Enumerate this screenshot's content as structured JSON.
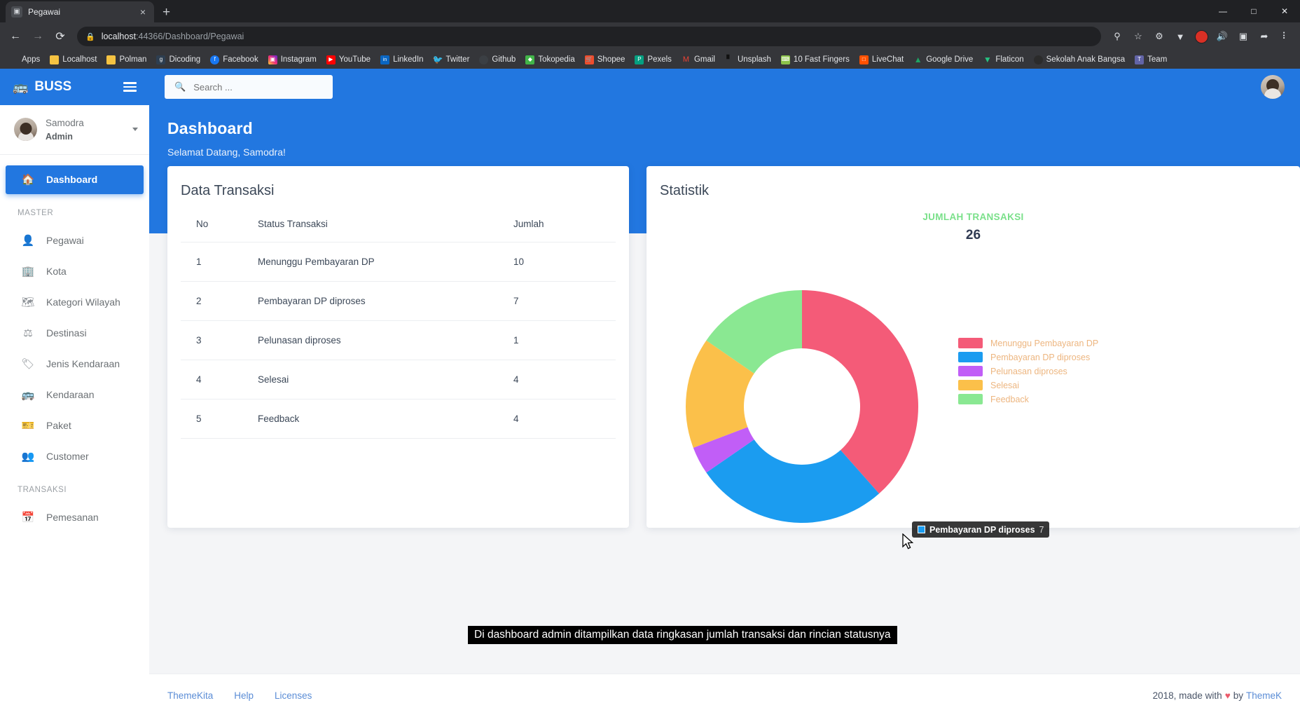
{
  "browser": {
    "tab": {
      "title": "Pegawai",
      "favicon": "page-icon",
      "close": "×"
    },
    "new_tab": "+",
    "window_controls": {
      "minimize": "—",
      "maximize": "□",
      "close": "✕"
    },
    "nav": {
      "back": "←",
      "forward": "→",
      "reload": "⟳"
    },
    "omnibox": {
      "lock_icon": "lock-icon",
      "url_host": "localhost",
      "url_path": ":44366/Dashboard/Pegawai"
    },
    "toolbar_icons": [
      "key-icon",
      "star-icon",
      "extensions-icon",
      "vpn-icon",
      "profile-avatar-icon",
      "mute-icon",
      "cast-icon",
      "share-icon",
      "menu-icon"
    ],
    "bookmarks": [
      {
        "label": "Apps",
        "color": "#9aa0a6",
        "glyph": ""
      },
      {
        "label": "Localhost",
        "color": "#f5c342",
        "glyph": ""
      },
      {
        "label": "Polman",
        "color": "#f5c342",
        "glyph": ""
      },
      {
        "label": "Dicoding",
        "color": "#2d3e50",
        "glyph": "g"
      },
      {
        "label": "Facebook",
        "color": "#1877f2",
        "glyph": "f"
      },
      {
        "label": "Instagram",
        "color": "#e4405f",
        "glyph": "▣"
      },
      {
        "label": "YouTube",
        "color": "#ff0000",
        "glyph": "▶"
      },
      {
        "label": "LinkedIn",
        "color": "#0a66c2",
        "glyph": "in"
      },
      {
        "label": "Twitter",
        "color": "#1da1f2",
        "glyph": "✈"
      },
      {
        "label": "Github",
        "color": "#24292e",
        "glyph": "●"
      },
      {
        "label": "Tokopedia",
        "color": "#42b549",
        "glyph": "◆"
      },
      {
        "label": "Shopee",
        "color": "#ee4d2d",
        "glyph": "▲"
      },
      {
        "label": "Pexels",
        "color": "#05a081",
        "glyph": "P"
      },
      {
        "label": "Gmail",
        "color": "#ea4335",
        "glyph": "M"
      },
      {
        "label": "Unsplash",
        "color": "#111111",
        "glyph": "∴"
      },
      {
        "label": "10 Fast Fingers",
        "color": "#8bc34a",
        "glyph": "⌨"
      },
      {
        "label": "LiveChat",
        "color": "#ff5100",
        "glyph": "□"
      },
      {
        "label": "Google Drive",
        "color": "#1fa463",
        "glyph": "△"
      },
      {
        "label": "Flaticon",
        "color": "#26c281",
        "glyph": "▽"
      },
      {
        "label": "Sekolah Anak Bangsa",
        "color": "#2b2b2b",
        "glyph": "○"
      },
      {
        "label": "Team",
        "color": "#6264a7",
        "glyph": "T"
      }
    ]
  },
  "sidebar": {
    "brand": "BUSS",
    "brand_icon": "bus-icon",
    "hamburger_icon": "hamburger-icon",
    "user": {
      "name": "Samodra",
      "role": "Admin",
      "caret_icon": "chevron-down-icon"
    },
    "items": [
      {
        "label": "Dashboard",
        "icon": "home-icon",
        "active": true
      },
      {
        "label": "Pegawai",
        "icon": "user-icon",
        "active": false
      },
      {
        "label": "Kota",
        "icon": "building-icon",
        "active": false
      },
      {
        "label": "Kategori Wilayah",
        "icon": "map-icon",
        "active": false
      },
      {
        "label": "Destinasi",
        "icon": "signpost-icon",
        "active": false
      },
      {
        "label": "Jenis Kendaraan",
        "icon": "tag-icon",
        "active": false
      },
      {
        "label": "Kendaraan",
        "icon": "bus-icon",
        "active": false
      },
      {
        "label": "Paket",
        "icon": "ticket-icon",
        "active": false
      },
      {
        "label": "Customer",
        "icon": "users-icon",
        "active": false
      },
      {
        "label": "Pemesanan",
        "icon": "calendar-check-icon",
        "active": false
      }
    ],
    "sections": {
      "master": "MASTER",
      "transaksi": "TRANSAKSI"
    }
  },
  "topnav": {
    "search_placeholder": "Search ...",
    "search_value": "",
    "search_icon": "search-icon",
    "avatar": "user-avatar"
  },
  "hero": {
    "title": "Dashboard",
    "greeting": "Selamat Datang, Samodra!"
  },
  "transaksi_card": {
    "title": "Data Transaksi",
    "columns": [
      "No",
      "Status Transaksi",
      "Jumlah"
    ],
    "rows": [
      {
        "no": "1",
        "status": "Menunggu Pembayaran DP",
        "jumlah": "10"
      },
      {
        "no": "2",
        "status": "Pembayaran DP diproses",
        "jumlah": "7"
      },
      {
        "no": "3",
        "status": "Pelunasan diproses",
        "jumlah": "1"
      },
      {
        "no": "4",
        "status": "Selesai",
        "jumlah": "4"
      },
      {
        "no": "5",
        "status": "Feedback",
        "jumlah": "4"
      }
    ]
  },
  "statistik_card": {
    "title": "Statistik",
    "total_label": "JUMLAH TRANSAKSI",
    "total_value": "26",
    "tooltip": {
      "label": "Pembayaran DP diproses",
      "separator": ":",
      "value": "7"
    }
  },
  "chart_data": {
    "type": "pie",
    "title": "Statistik",
    "subtitle": "JUMLAH TRANSAKSI",
    "total": 26,
    "donut": true,
    "inner_radius_ratio": 0.5,
    "legend_position": "right",
    "categories": [
      "Menunggu Pembayaran DP",
      "Pembayaran DP diproses",
      "Pelunasan diproses",
      "Selesai",
      "Feedback"
    ],
    "values": [
      10,
      7,
      1,
      4,
      4
    ],
    "colors": [
      "#f45b78",
      "#1b9cf0",
      "#c15ef7",
      "#fbc04a",
      "#8ae892"
    ],
    "start_angle_deg": 0,
    "hovered_slice": "Pembayaran DP diproses"
  },
  "caption": {
    "text": "Di dashboard admin ditampilkan data ringkasan jumlah transaksi dan rincian statusnya"
  },
  "footer": {
    "links": [
      "ThemeKita",
      "Help",
      "Licenses"
    ],
    "copyright_prefix": "2018, made with",
    "heart": "♥",
    "copyright_mid": "by",
    "brand": "ThemeK"
  },
  "colors": {
    "primary": "#2277e0",
    "accent_green": "#7ae08a",
    "text_dark": "#3c4858"
  }
}
